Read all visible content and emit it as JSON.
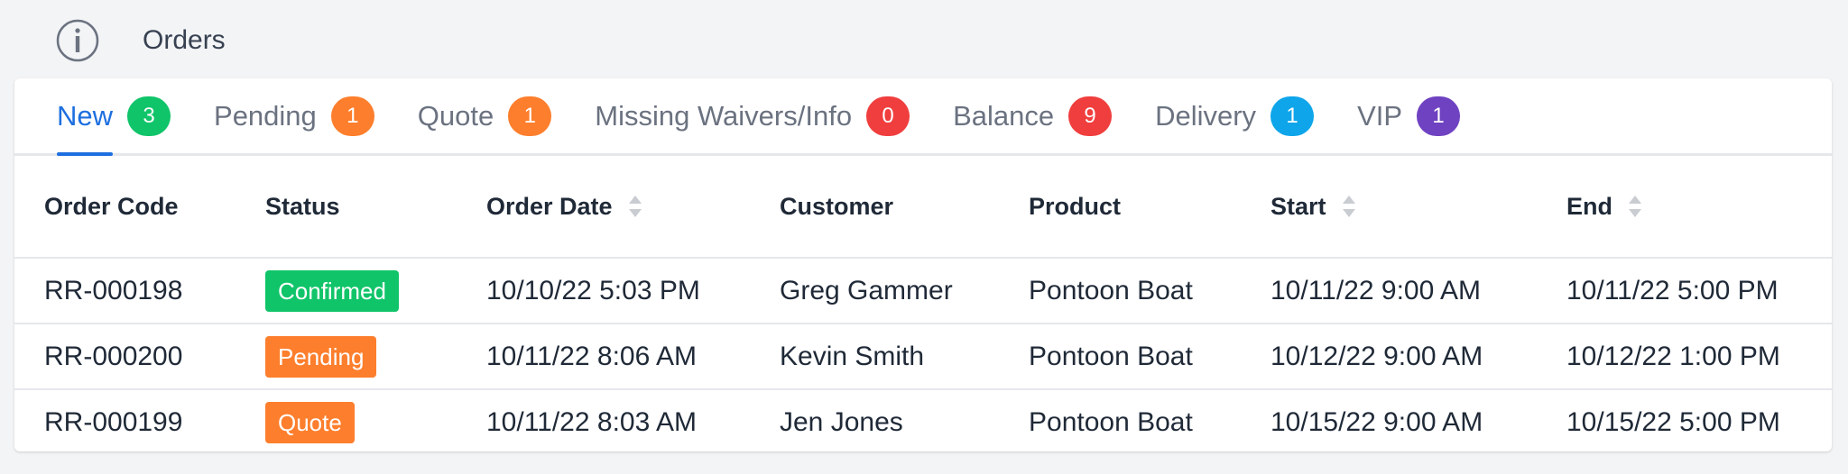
{
  "header": {
    "title": "Orders",
    "icon": "info-circle-icon"
  },
  "tabs": [
    {
      "label": "New",
      "count": "3",
      "color": "#10c469",
      "active": true
    },
    {
      "label": "Pending",
      "count": "1",
      "color": "#fd7e2c",
      "active": false
    },
    {
      "label": "Quote",
      "count": "1",
      "color": "#fd7e2c",
      "active": false
    },
    {
      "label": "Missing Waivers/Info",
      "count": "0",
      "color": "#f03e3e",
      "active": false
    },
    {
      "label": "Balance",
      "count": "9",
      "color": "#f03e3e",
      "active": false
    },
    {
      "label": "Delivery",
      "count": "1",
      "color": "#0ea5ea",
      "active": false
    },
    {
      "label": "VIP",
      "count": "1",
      "color": "#6f42c1",
      "active": false
    }
  ],
  "table": {
    "columns": [
      {
        "label": "Order Code",
        "sortable": false
      },
      {
        "label": "Status",
        "sortable": false
      },
      {
        "label": "Order Date",
        "sortable": true
      },
      {
        "label": "Customer",
        "sortable": false
      },
      {
        "label": "Product",
        "sortable": false
      },
      {
        "label": "Start",
        "sortable": true
      },
      {
        "label": "End",
        "sortable": true
      }
    ],
    "rows": [
      {
        "code": "RR-000198",
        "status": "Confirmed",
        "status_color": "#10c469",
        "order_date": "10/10/22 5:03 PM",
        "customer": "Greg Gammer",
        "product": "Pontoon Boat",
        "start": "10/11/22 9:00 AM",
        "end": "10/11/22 5:00 PM"
      },
      {
        "code": "RR-000200",
        "status": "Pending",
        "status_color": "#fd7e2c",
        "order_date": "10/11/22 8:06 AM",
        "customer": "Kevin Smith",
        "product": "Pontoon Boat",
        "start": "10/12/22 9:00 AM",
        "end": "10/12/22 1:00 PM"
      },
      {
        "code": "RR-000199",
        "status": "Quote",
        "status_color": "#fd7e2c",
        "order_date": "10/11/22 8:03 AM",
        "customer": "Jen Jones",
        "product": "Pontoon Boat",
        "start": "10/15/22 9:00 AM",
        "end": "10/15/22 5:00 PM"
      }
    ]
  }
}
